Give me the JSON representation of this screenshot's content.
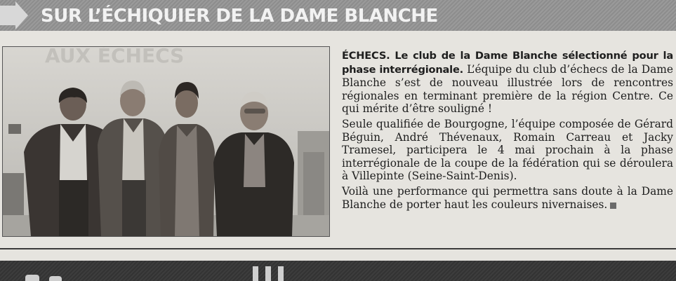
{
  "header": {
    "title": "SUR L’ÉCHIQUIER DE LA DAME BLANCHE"
  },
  "article": {
    "lead": "ÉCHECS. Le club de la Dame Blanche sélectionné pour la phase interrégionale.",
    "p1": "L’équipe du club d’échecs de la Dame Blanche s’est de nouveau illustrée lors de rencontres régionales en terminant première de la région Centre. Ce qui mérite d’être souligné !",
    "p2": "Seule qualifiée de Bourgogne, l’équipe composée de Gérard Béguin, André Thévenaux, Romain Carreau et Jacky Tramesel, participera le 4 mai prochain à la phase interrégionale de la coupe de la fédération qui se déroulera à Villepinte (Seine-Saint-Denis).",
    "p3": "Voilà une performance qui permettra sans doute à la Dame Blanche de porter haut les couleurs nivernaises."
  },
  "colors": {
    "header_band": "#959595",
    "header_text": "#f2f2f2",
    "paper": "#e6e4df",
    "bottom_band": "#383838"
  }
}
